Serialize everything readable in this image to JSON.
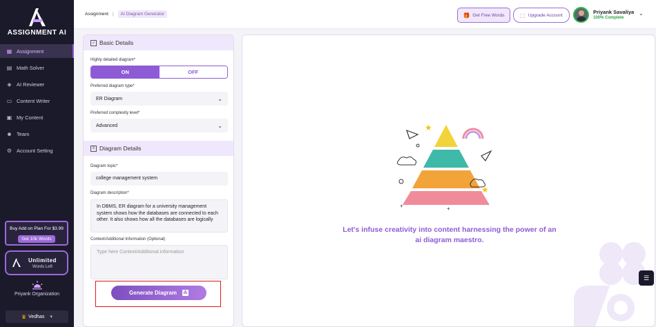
{
  "brand": {
    "name": "ASSIGNMENT AI"
  },
  "sidebar": {
    "items": [
      {
        "label": "Assignment",
        "icon": "grid-icon"
      },
      {
        "label": "Math Solver",
        "icon": "calculator-icon"
      },
      {
        "label": "AI Reviewer",
        "icon": "ai-icon"
      },
      {
        "label": "Content Writer",
        "icon": "document-icon"
      },
      {
        "label": "My Content",
        "icon": "folder-icon"
      },
      {
        "label": "Team",
        "icon": "team-icon"
      },
      {
        "label": "Account Setting",
        "icon": "gear-icon"
      }
    ],
    "promo": {
      "title": "Buy Add on Plan For $3.99",
      "button": "Get 10k Words"
    },
    "plan": {
      "title": "Unlimited",
      "subtitle": "Words Left"
    },
    "org": {
      "name": "Priyank Organization",
      "selected": "Vedhas"
    }
  },
  "header": {
    "breadcrumb": [
      "Assignment",
      "AI Diagram Generator"
    ],
    "free_words": "Get Free Words",
    "upgrade": "Upgrade Account",
    "user": {
      "name": "Priyank Savaliya",
      "status": "100% Complete"
    }
  },
  "form": {
    "basic_title": "Basic Details",
    "detailed_label": "Highly detailed diagram*",
    "toggle_on": "ON",
    "toggle_off": "OFF",
    "diagram_type_label": "Preferred diagram type*",
    "diagram_type_value": "ER Diagram",
    "complexity_label": "Preferred complexity level*",
    "complexity_value": "Advanced",
    "details_title": "Diagram Details",
    "topic_label": "Diagram topic*",
    "topic_value": "college management system",
    "description_label": "Diagram description*",
    "description_value": "In DBMS, ER diagram for a university management system shows how the databases are connected to each other. It also shows how all the databases are logically",
    "context_label": "Context/Additional Information (Optional)",
    "context_placeholder": "Type here Context/Additional information",
    "generate_button": "Generate Diagram"
  },
  "preview": {
    "message": "Let's infuse creativity into content harnessing the power of an ai diagram maestro."
  },
  "colors": {
    "accent": "#8e5bd6",
    "sidebar_bg": "#1b1a2a",
    "success": "#2fa144",
    "highlight": "#e0161b"
  }
}
